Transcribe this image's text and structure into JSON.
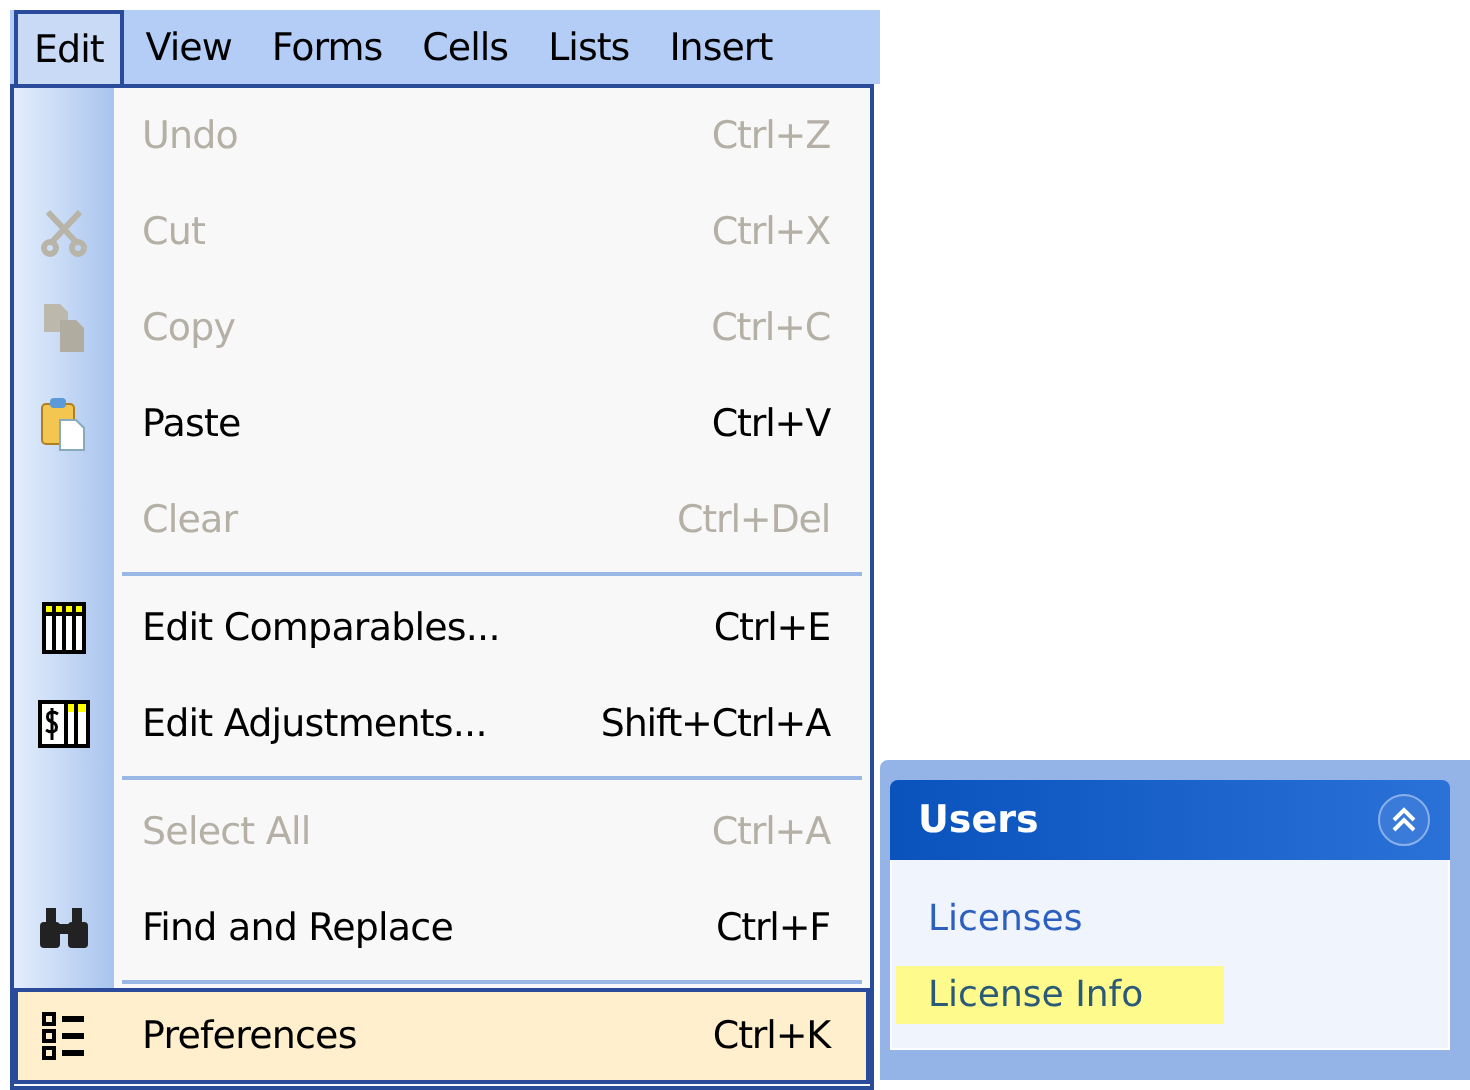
{
  "menubar": [
    {
      "label": "Edit",
      "selected": true
    },
    {
      "label": "View",
      "selected": false
    },
    {
      "label": "Forms",
      "selected": false
    },
    {
      "label": "Cells",
      "selected": false
    },
    {
      "label": "Lists",
      "selected": false
    },
    {
      "label": "Insert",
      "selected": false
    }
  ],
  "menu": [
    {
      "kind": "item",
      "label": "Undo",
      "shortcut": "Ctrl+Z",
      "disabled": true,
      "selected": false
    },
    {
      "kind": "item",
      "label": "Cut",
      "shortcut": "Ctrl+X",
      "disabled": true,
      "selected": false
    },
    {
      "kind": "item",
      "label": "Copy",
      "shortcut": "Ctrl+C",
      "disabled": true,
      "selected": false
    },
    {
      "kind": "item",
      "label": "Paste",
      "shortcut": "Ctrl+V",
      "disabled": false,
      "selected": false
    },
    {
      "kind": "item",
      "label": "Clear",
      "shortcut": "Ctrl+Del",
      "disabled": true,
      "selected": false
    },
    {
      "kind": "separator"
    },
    {
      "kind": "item",
      "label": "Edit Comparables...",
      "shortcut": "Ctrl+E",
      "disabled": false,
      "selected": false
    },
    {
      "kind": "item",
      "label": "Edit Adjustments...",
      "shortcut": "Shift+Ctrl+A",
      "disabled": false,
      "selected": false
    },
    {
      "kind": "separator"
    },
    {
      "kind": "item",
      "label": "Select All",
      "shortcut": "Ctrl+A",
      "disabled": true,
      "selected": false
    },
    {
      "kind": "item",
      "label": "Find and Replace",
      "shortcut": "Ctrl+F",
      "disabled": false,
      "selected": false
    },
    {
      "kind": "separator"
    },
    {
      "kind": "item",
      "label": "Preferences",
      "shortcut": "Ctrl+K",
      "disabled": false,
      "selected": true
    }
  ],
  "panel": {
    "title": "Users",
    "expanded": true,
    "links": [
      {
        "label": "Licenses",
        "selected": false
      },
      {
        "label": "License Info",
        "selected": true
      }
    ]
  }
}
